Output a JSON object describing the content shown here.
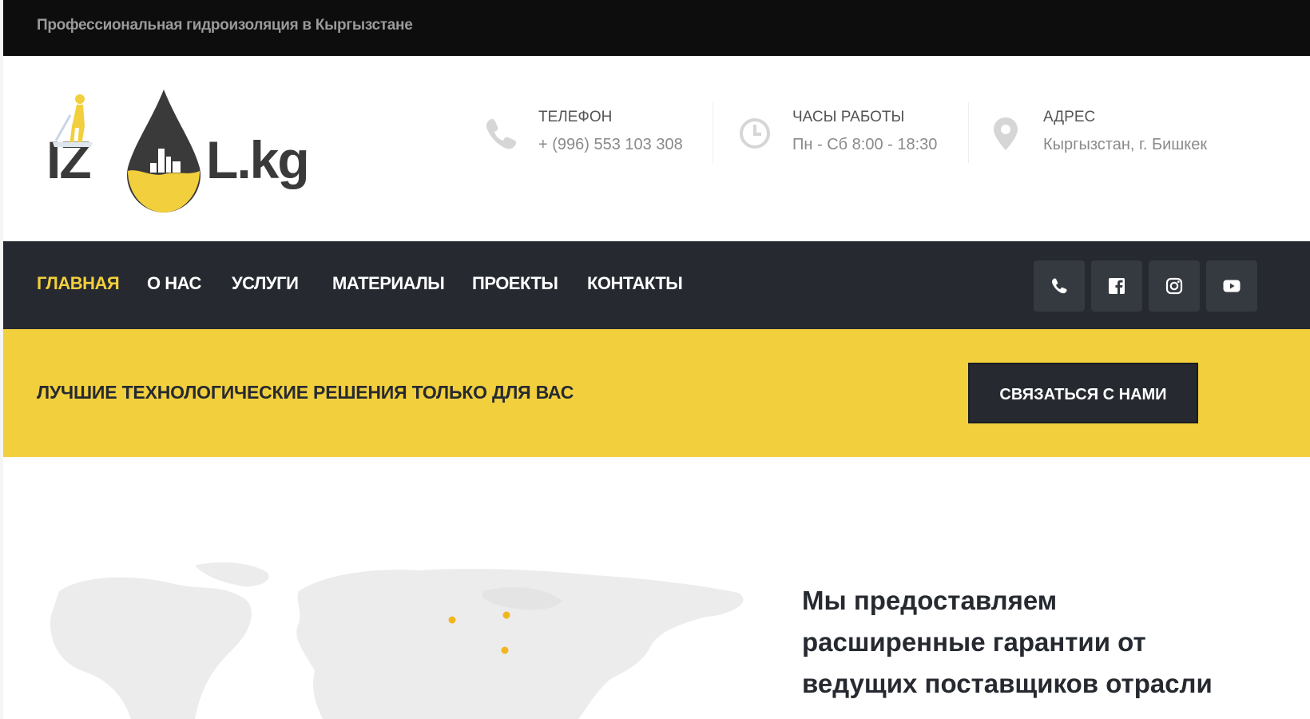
{
  "topbar": {
    "tagline": "Профессиональная гидроизоляция в Кыргызстане"
  },
  "logo": {
    "left_text": "IZ",
    "right_text": "L.kg"
  },
  "contact": [
    {
      "icon": "phone-icon",
      "title": "ТЕЛЕФОН",
      "value": "+ (996) 553 103 308"
    },
    {
      "icon": "clock-icon",
      "title": "ЧАСЫ РАБОТЫ",
      "value": "Пн - Сб 8:00 - 18:30"
    },
    {
      "icon": "location-pin-icon",
      "title": "АДРЕС",
      "value": "Кыргызстан, г. Бишкек"
    }
  ],
  "nav": {
    "items": [
      {
        "label": "ГЛАВНАЯ",
        "active": true
      },
      {
        "label": "О НАС"
      },
      {
        "label": "УСЛУГИ"
      },
      {
        "label": "МАТЕРИАЛЫ"
      },
      {
        "label": "ПРОЕКТЫ"
      },
      {
        "label": "КОНТАКТЫ"
      }
    ],
    "social_icons": [
      "phone-icon",
      "facebook-icon",
      "instagram-icon",
      "youtube-icon"
    ]
  },
  "banner": {
    "text": "ЛУЧШИЕ ТЕХНОЛОГИЧЕСКИЕ РЕШЕНИЯ ТОЛЬКО ДЛЯ ВАС",
    "button": "СВЯЗАТЬСЯ С НАМИ"
  },
  "main": {
    "headline_lines": [
      "Мы предоставляем",
      "расширенные гарантии от",
      "ведущих поставщиков отрасли"
    ]
  },
  "colors": {
    "accent": "#f2cf3d",
    "dark": "#262a30",
    "topbar": "#0d0d0d"
  }
}
